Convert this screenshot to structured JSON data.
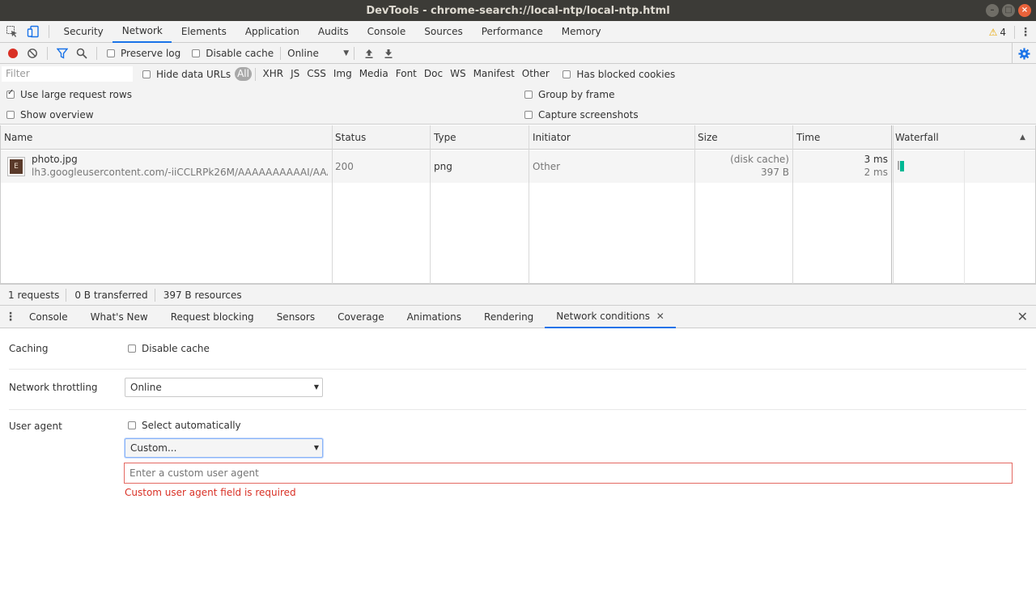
{
  "window": {
    "title": "DevTools - chrome-search://local-ntp/local-ntp.html"
  },
  "tabs": [
    "Security",
    "Network",
    "Elements",
    "Application",
    "Audits",
    "Console",
    "Sources",
    "Performance",
    "Memory"
  ],
  "active_tab": "Network",
  "warnings": {
    "count": "4"
  },
  "toolbar": {
    "preserve_log": "Preserve log",
    "disable_cache": "Disable cache",
    "throttle": "Online"
  },
  "filterbar": {
    "placeholder": "Filter",
    "hide_data_urls": "Hide data URLs",
    "types": [
      "All",
      "XHR",
      "JS",
      "CSS",
      "Img",
      "Media",
      "Font",
      "Doc",
      "WS",
      "Manifest",
      "Other"
    ],
    "has_blocked_cookies": "Has blocked cookies"
  },
  "settings": {
    "large_rows": "Use large request rows",
    "overview": "Show overview",
    "group_by_frame": "Group by frame",
    "capture_screenshots": "Capture screenshots"
  },
  "columns": [
    "Name",
    "Status",
    "Type",
    "Initiator",
    "Size",
    "Time",
    "Waterfall"
  ],
  "request": {
    "icon_letter": "E",
    "name": "photo.jpg",
    "url": "lh3.googleusercontent.com/-iiCCLRPk26M/AAAAAAAAAAI/AAAA...",
    "status": "200",
    "type": "png",
    "initiator": "Other",
    "size_top": "(disk cache)",
    "size_bottom": "397 B",
    "time_top": "3 ms",
    "time_bottom": "2 ms"
  },
  "summary": {
    "requests": "1 requests",
    "transferred": "0 B transferred",
    "resources": "397 B resources"
  },
  "drawer": {
    "tabs": [
      "Console",
      "What's New",
      "Request blocking",
      "Sensors",
      "Coverage",
      "Animations",
      "Rendering",
      "Network conditions"
    ]
  },
  "network_conditions": {
    "caching_label": "Caching",
    "disable_cache": "Disable cache",
    "throttling_label": "Network throttling",
    "throttling_value": "Online",
    "ua_label": "User agent",
    "select_auto": "Select automatically",
    "ua_select": "Custom...",
    "ua_placeholder": "Enter a custom user agent",
    "ua_error": "Custom user agent field is required"
  },
  "colors": {
    "accent": "#1a73e8",
    "record": "#d93025",
    "error": "#d93025",
    "waterfall": "#00b894"
  }
}
